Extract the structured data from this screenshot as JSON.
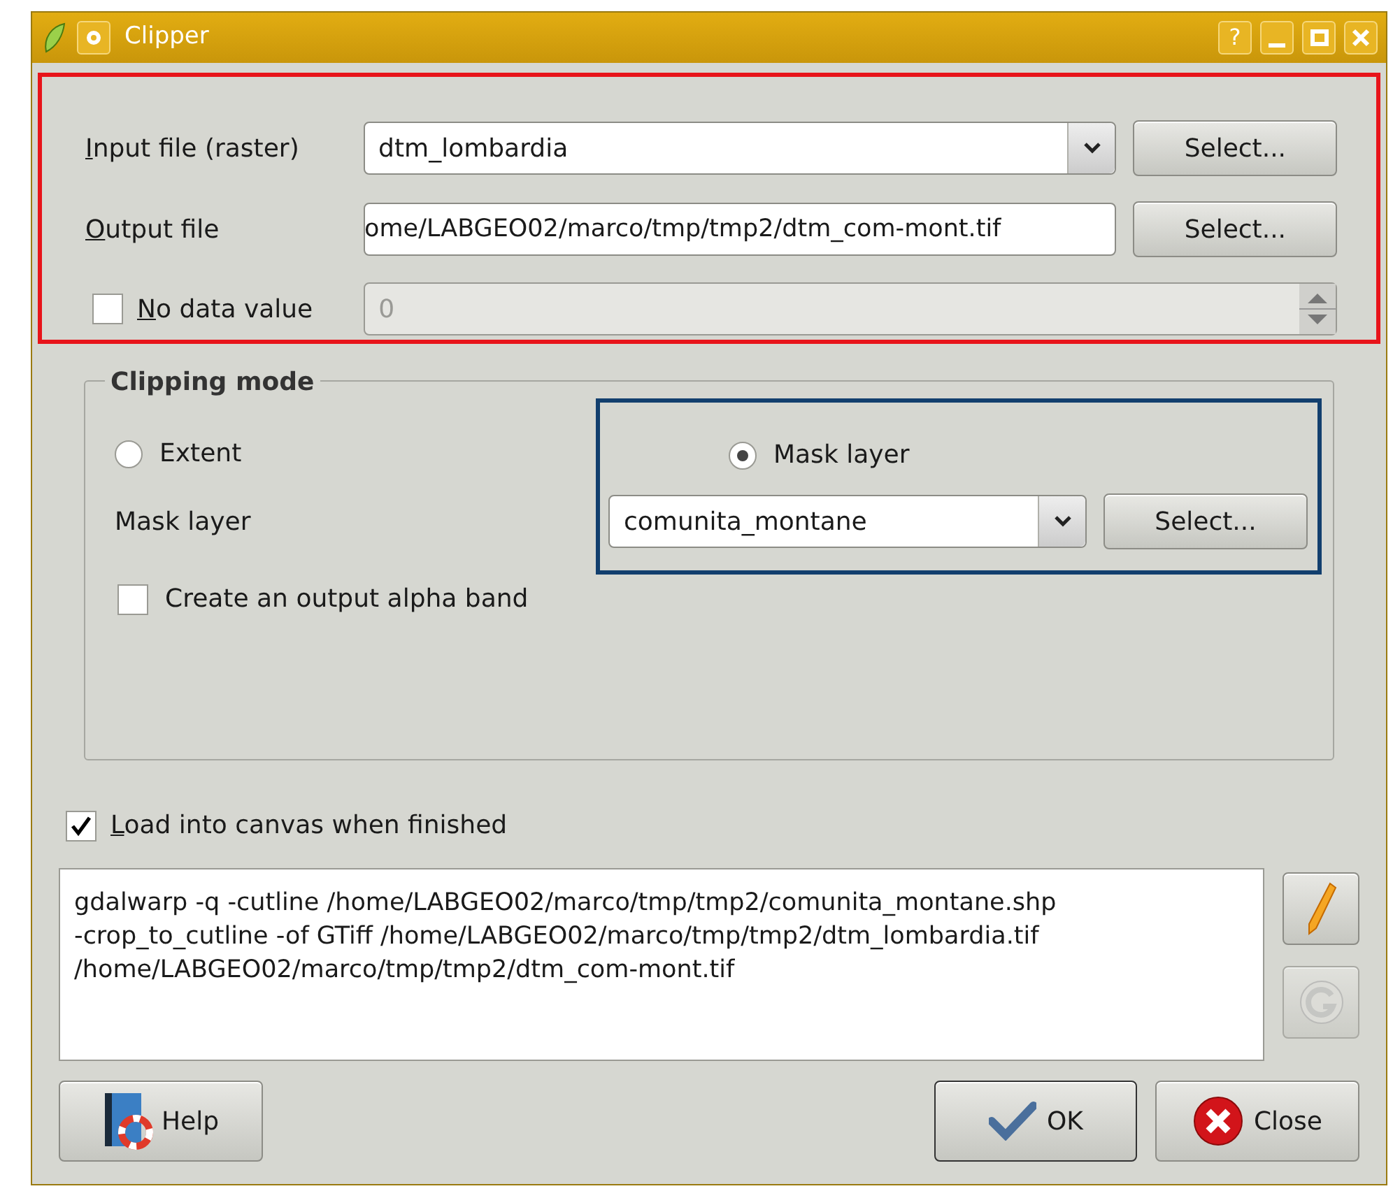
{
  "window": {
    "title": "Clipper",
    "title_buttons": [
      "?"
    ]
  },
  "input_file": {
    "label": "Input file (raster)",
    "mnemonic": true,
    "value": "dtm_lombardia",
    "button": "Select..."
  },
  "output_file": {
    "label": "Output file",
    "mnemonic": true,
    "value": "ome/LABGEO02/marco/tmp/tmp2/dtm_com-mont.tif",
    "button": "Select..."
  },
  "no_data": {
    "label": "No data value",
    "mnemonic": true,
    "checked": false,
    "value": "0",
    "disabled": true
  },
  "clipping_mode": {
    "title": "Clipping mode",
    "modes": [
      {
        "label": "Extent",
        "selected": false
      },
      {
        "label": "Mask layer",
        "selected": true
      }
    ],
    "mask_label": "Mask layer",
    "mask_value": "comunita_montane",
    "mask_button": "Select...",
    "alpha_band": {
      "label": "Create an output alpha band",
      "checked": false
    }
  },
  "load_canvas": {
    "label": "Load into canvas when finished",
    "mnemonic": true,
    "checked": true
  },
  "command": "gdalwarp -q -cutline /home/LABGEO02/marco/tmp/tmp2/comunita_montane.shp\n-crop_to_cutline -of GTiff /home/LABGEO02/marco/tmp/tmp2/dtm_lombardia.tif\n/home/LABGEO02/marco/tmp/tmp2/dtm_com-mont.tif",
  "buttons": {
    "help": "Help",
    "ok": "OK",
    "close": "Close"
  }
}
